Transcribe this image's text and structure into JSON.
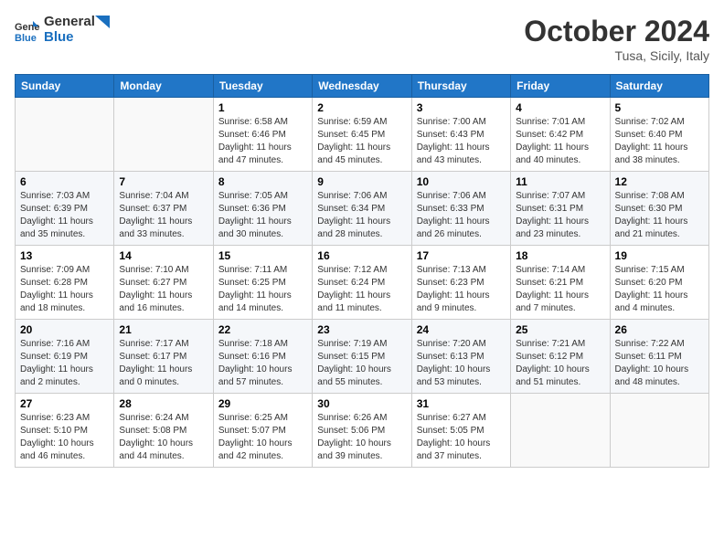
{
  "logo": {
    "text_general": "General",
    "text_blue": "Blue"
  },
  "header": {
    "month": "October 2024",
    "location": "Tusa, Sicily, Italy"
  },
  "weekdays": [
    "Sunday",
    "Monday",
    "Tuesday",
    "Wednesday",
    "Thursday",
    "Friday",
    "Saturday"
  ],
  "weeks": [
    [
      null,
      null,
      {
        "day": "1",
        "sunrise": "6:58 AM",
        "sunset": "6:46 PM",
        "daylight": "11 hours and 47 minutes."
      },
      {
        "day": "2",
        "sunrise": "6:59 AM",
        "sunset": "6:45 PM",
        "daylight": "11 hours and 45 minutes."
      },
      {
        "day": "3",
        "sunrise": "7:00 AM",
        "sunset": "6:43 PM",
        "daylight": "11 hours and 43 minutes."
      },
      {
        "day": "4",
        "sunrise": "7:01 AM",
        "sunset": "6:42 PM",
        "daylight": "11 hours and 40 minutes."
      },
      {
        "day": "5",
        "sunrise": "7:02 AM",
        "sunset": "6:40 PM",
        "daylight": "11 hours and 38 minutes."
      }
    ],
    [
      {
        "day": "6",
        "sunrise": "7:03 AM",
        "sunset": "6:39 PM",
        "daylight": "11 hours and 35 minutes."
      },
      {
        "day": "7",
        "sunrise": "7:04 AM",
        "sunset": "6:37 PM",
        "daylight": "11 hours and 33 minutes."
      },
      {
        "day": "8",
        "sunrise": "7:05 AM",
        "sunset": "6:36 PM",
        "daylight": "11 hours and 30 minutes."
      },
      {
        "day": "9",
        "sunrise": "7:06 AM",
        "sunset": "6:34 PM",
        "daylight": "11 hours and 28 minutes."
      },
      {
        "day": "10",
        "sunrise": "7:06 AM",
        "sunset": "6:33 PM",
        "daylight": "11 hours and 26 minutes."
      },
      {
        "day": "11",
        "sunrise": "7:07 AM",
        "sunset": "6:31 PM",
        "daylight": "11 hours and 23 minutes."
      },
      {
        "day": "12",
        "sunrise": "7:08 AM",
        "sunset": "6:30 PM",
        "daylight": "11 hours and 21 minutes."
      }
    ],
    [
      {
        "day": "13",
        "sunrise": "7:09 AM",
        "sunset": "6:28 PM",
        "daylight": "11 hours and 18 minutes."
      },
      {
        "day": "14",
        "sunrise": "7:10 AM",
        "sunset": "6:27 PM",
        "daylight": "11 hours and 16 minutes."
      },
      {
        "day": "15",
        "sunrise": "7:11 AM",
        "sunset": "6:25 PM",
        "daylight": "11 hours and 14 minutes."
      },
      {
        "day": "16",
        "sunrise": "7:12 AM",
        "sunset": "6:24 PM",
        "daylight": "11 hours and 11 minutes."
      },
      {
        "day": "17",
        "sunrise": "7:13 AM",
        "sunset": "6:23 PM",
        "daylight": "11 hours and 9 minutes."
      },
      {
        "day": "18",
        "sunrise": "7:14 AM",
        "sunset": "6:21 PM",
        "daylight": "11 hours and 7 minutes."
      },
      {
        "day": "19",
        "sunrise": "7:15 AM",
        "sunset": "6:20 PM",
        "daylight": "11 hours and 4 minutes."
      }
    ],
    [
      {
        "day": "20",
        "sunrise": "7:16 AM",
        "sunset": "6:19 PM",
        "daylight": "11 hours and 2 minutes."
      },
      {
        "day": "21",
        "sunrise": "7:17 AM",
        "sunset": "6:17 PM",
        "daylight": "11 hours and 0 minutes."
      },
      {
        "day": "22",
        "sunrise": "7:18 AM",
        "sunset": "6:16 PM",
        "daylight": "10 hours and 57 minutes."
      },
      {
        "day": "23",
        "sunrise": "7:19 AM",
        "sunset": "6:15 PM",
        "daylight": "10 hours and 55 minutes."
      },
      {
        "day": "24",
        "sunrise": "7:20 AM",
        "sunset": "6:13 PM",
        "daylight": "10 hours and 53 minutes."
      },
      {
        "day": "25",
        "sunrise": "7:21 AM",
        "sunset": "6:12 PM",
        "daylight": "10 hours and 51 minutes."
      },
      {
        "day": "26",
        "sunrise": "7:22 AM",
        "sunset": "6:11 PM",
        "daylight": "10 hours and 48 minutes."
      }
    ],
    [
      {
        "day": "27",
        "sunrise": "6:23 AM",
        "sunset": "5:10 PM",
        "daylight": "10 hours and 46 minutes."
      },
      {
        "day": "28",
        "sunrise": "6:24 AM",
        "sunset": "5:08 PM",
        "daylight": "10 hours and 44 minutes."
      },
      {
        "day": "29",
        "sunrise": "6:25 AM",
        "sunset": "5:07 PM",
        "daylight": "10 hours and 42 minutes."
      },
      {
        "day": "30",
        "sunrise": "6:26 AM",
        "sunset": "5:06 PM",
        "daylight": "10 hours and 39 minutes."
      },
      {
        "day": "31",
        "sunrise": "6:27 AM",
        "sunset": "5:05 PM",
        "daylight": "10 hours and 37 minutes."
      },
      null,
      null
    ]
  ]
}
